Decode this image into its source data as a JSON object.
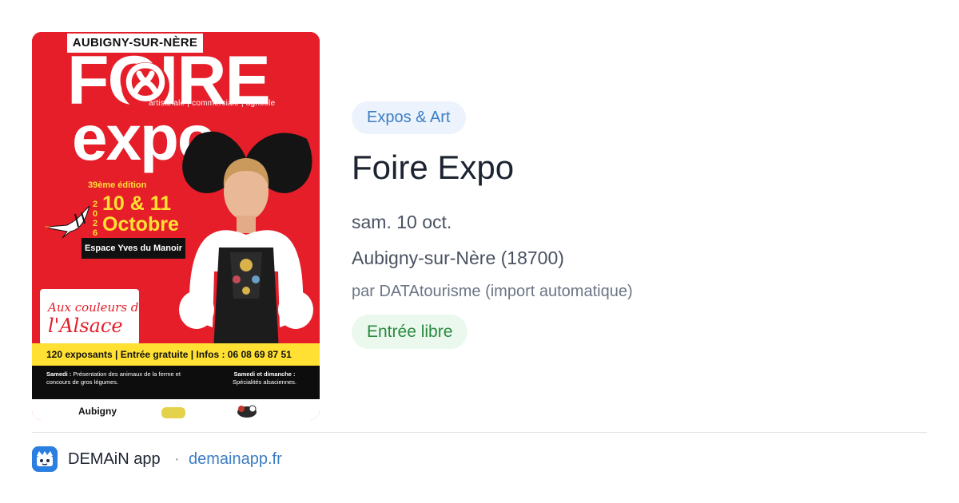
{
  "poster": {
    "town": "AUBIGNY-SUR-NÈRE",
    "foire": "FOIRE",
    "subtype": "artisanale | commerciale | agricole",
    "expo": "expo",
    "edition": "39ème édition",
    "year_digits": [
      "2",
      "0",
      "2",
      "6"
    ],
    "date_line1": "10 & 11",
    "date_line2": "Octobre",
    "venue": "Espace Yves du Manoir",
    "theme_line1": "Aux couleurs de",
    "theme_line2": "l'Alsace",
    "info_bar": "120 exposants | Entrée gratuite | Infos : 06 08 69 87 51",
    "saturday_title": "Samedi :",
    "saturday_text": "Présentation des animaux de la ferme et concours de gros légumes.",
    "weekend_title": "Samedi et dimanche :",
    "weekend_text": "Spécialités alsaciennes.",
    "logo_aubigny": "Aubigny"
  },
  "event": {
    "category": "Expos & Art",
    "title": "Foire Expo",
    "date": "sam. 10 oct.",
    "location": "Aubigny-sur-Nère (18700)",
    "organizer": "par DATAtourisme (import automatique)",
    "price": "Entrée libre"
  },
  "footer": {
    "app_name": "DEMAiN app",
    "separator": "·",
    "url": "demainapp.fr",
    "app_icon": "demain-app-icon"
  },
  "colors": {
    "poster_red": "#e51e29",
    "poster_yellow": "#ffe033",
    "category_text": "#3b7dc4",
    "category_bg": "#ecf3fc",
    "price_text": "#2a8a3e",
    "price_bg": "#ebf8ee",
    "link": "#3b7dc4"
  }
}
